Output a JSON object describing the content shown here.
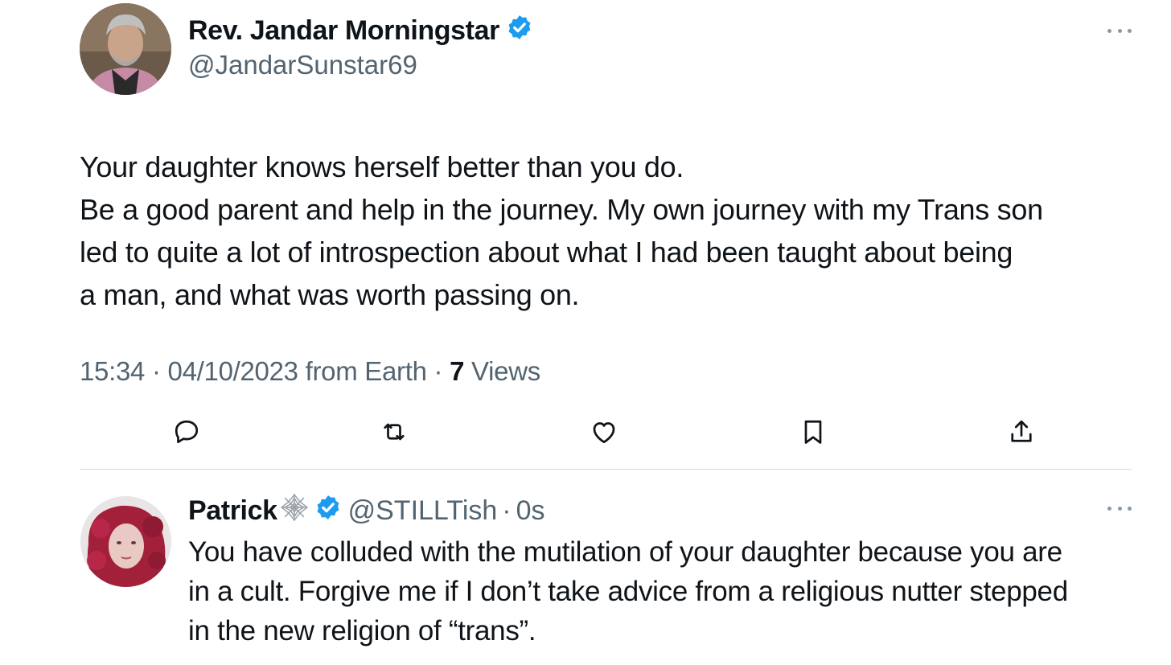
{
  "tweet": {
    "author": {
      "display_name": "Rev. Jandar Morningstar",
      "handle": "@JandarSunstar69",
      "verified": true
    },
    "text_lines": [
      "Your daughter knows herself better than you do.",
      "Be a good parent and help in the journey. My own journey with my Trans son",
      "led to quite a lot of introspection about what I had been taught about being",
      "a man, and what was worth passing on."
    ],
    "meta": {
      "time": "15:34",
      "date": "04/10/2023",
      "source": "from Earth",
      "separator": "·",
      "views_count": "7",
      "views_label": "Views"
    },
    "actions": [
      "reply-icon",
      "retweet-icon",
      "like-icon",
      "bookmark-icon",
      "share-icon"
    ]
  },
  "reply": {
    "author": {
      "display_name": "Patrick",
      "emoji": "🕸",
      "handle": "@STILLTish",
      "verified": true
    },
    "separator": "·",
    "time": "0s",
    "text_lines": [
      "You have colluded with the mutilation of your daughter because you are",
      "in a cult. Forgive me if I don’t take advice from a religious nutter stepped",
      "in the new religion of “trans”."
    ]
  },
  "colors": {
    "text": "#0f1419",
    "secondary": "#536471",
    "verified": "#1d9bf0",
    "divider": "#cfd9de"
  }
}
